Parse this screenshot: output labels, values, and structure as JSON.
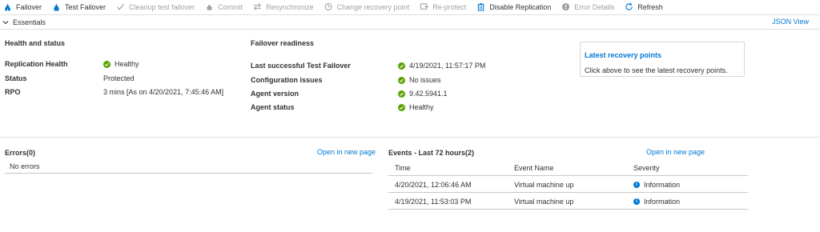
{
  "toolbar": {
    "failover": "Failover",
    "test_failover": "Test Failover",
    "cleanup": "Cleanup test failover",
    "commit": "Commit",
    "resync": "Resynchronize",
    "change_rp": "Change recovery point",
    "reprotect": "Re-protect",
    "disable": "Disable Replication",
    "error_details": "Error Details",
    "refresh": "Refresh"
  },
  "essentials": {
    "label": "Essentials",
    "json_view": "JSON View"
  },
  "health": {
    "title": "Health and status",
    "replication_health_label": "Replication Health",
    "replication_health_value": "Healthy",
    "status_label": "Status",
    "status_value": "Protected",
    "rpo_label": "RPO",
    "rpo_value": "3 mins [As on 4/20/2021, 7:45:46 AM]"
  },
  "failover_readiness": {
    "title": "Failover readiness",
    "last_test_label": "Last successful Test Failover",
    "last_test_value": "4/19/2021, 11:57:17 PM",
    "config_label": "Configuration issues",
    "config_value": "No issues",
    "agent_version_label": "Agent version",
    "agent_version_value": "9.42.5941.1",
    "agent_status_label": "Agent status",
    "agent_status_value": "Healthy"
  },
  "recovery_points": {
    "title": "Latest recovery points",
    "subtitle": "Click above to see the latest recovery points."
  },
  "errors": {
    "title": "Errors(0)",
    "open_link": "Open in new page",
    "empty": "No errors"
  },
  "events": {
    "title": "Events - Last 72 hours(2)",
    "open_link": "Open in new page",
    "columns": [
      "Time",
      "Event Name",
      "Severity"
    ],
    "rows": [
      {
        "time": "4/20/2021, 12:06:46 AM",
        "name": "Virtual machine up",
        "severity": "Information"
      },
      {
        "time": "4/19/2021, 11:53:03 PM",
        "name": "Virtual machine up",
        "severity": "Information"
      }
    ]
  },
  "colors": {
    "accent": "#0078d4",
    "success": "#57a300",
    "disabled": "#a19f9d"
  }
}
